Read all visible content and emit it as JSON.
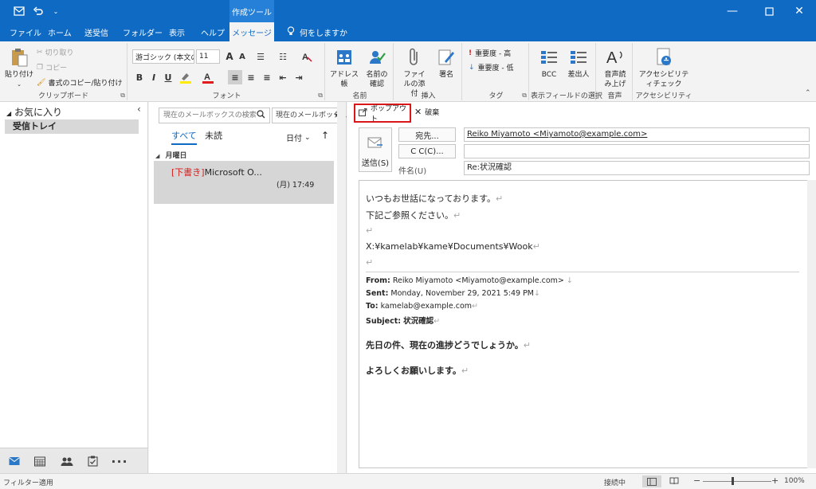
{
  "titlebar": {
    "context_tab": "作成ツール",
    "qat_icons": [
      "mail-app-icon",
      "undo-icon",
      "customize-qat-icon"
    ],
    "window_controls": [
      "minimize-icon",
      "maximize-icon",
      "close-icon"
    ]
  },
  "tabs": [
    {
      "label": "ファイル"
    },
    {
      "label": "ホーム"
    },
    {
      "label": "送受信"
    },
    {
      "label": "フォルダー"
    },
    {
      "label": "表示"
    },
    {
      "label": "ヘルプ"
    },
    {
      "label": "メッセージ",
      "active": true
    }
  ],
  "tell_me": "何をしますか",
  "ribbon": {
    "clipboard": {
      "paste": "貼り付け",
      "cut": "切り取り",
      "copy": "コピー",
      "format_painter": "書式のコピー/貼り付け",
      "label": "クリップボード"
    },
    "font": {
      "font_name": "游ゴシック (本文のフォ",
      "font_size": "11",
      "grow": "A",
      "shrink": "A",
      "bold": "B",
      "italic": "I",
      "underline": "U",
      "label": "フォント"
    },
    "names": {
      "address_book": "アドレス帳",
      "check_names": "名前の確認",
      "label": "名前"
    },
    "include": {
      "attach": "ファイルの添付",
      "signature": "署名",
      "label": "挿入"
    },
    "tags": {
      "high": "重要度 - 高",
      "low": "重要度 - 低",
      "label": "タグ"
    },
    "show_fields": {
      "bcc": "BCC",
      "from": "差出人",
      "label": "表示フィールドの選択"
    },
    "voice": {
      "dictate": "音声読み上げ",
      "label": "音声"
    },
    "accessibility": {
      "check": "アクセシビリティチェック",
      "label": "アクセシビリティ"
    }
  },
  "folder_pane": {
    "favorites": "お気に入り",
    "inbox": "受信トレイ",
    "nav_icons": [
      "mail-icon",
      "calendar-icon",
      "people-icon",
      "tasks-icon",
      "more-icon"
    ]
  },
  "message_list": {
    "search_placeholder": "現在のメールボックスの検索",
    "scope": "現在のメールボックス",
    "filter_all": "すべて",
    "filter_unread": "未読",
    "sort": "日付",
    "group": "月曜日",
    "items": [
      {
        "draft_tag": "[下書き]",
        "sender": "Microsoft O...",
        "time": "(月) 17:49"
      }
    ]
  },
  "compose": {
    "popout": "ポップアウト",
    "discard": "破棄",
    "send": "送信(S)",
    "to_button": "宛先...",
    "cc_button": "C C(C)...",
    "subject_label": "件名(U)",
    "to_value": "Reiko Miyamoto <Miyamoto@example.com>",
    "cc_value": "",
    "subject_value": "Re:状況確認",
    "body_lines": [
      "いつもお世話になっております。",
      "下記ご参照ください。",
      "",
      "X:¥kamelab¥kame¥Documents¥Wook",
      ""
    ],
    "quoted": {
      "from_label": "From:",
      "from": "Reiko Miyamoto <Miyamoto@example.com>",
      "sent_label": "Sent:",
      "sent": "Monday, November 29, 2021 5:49 PM",
      "to_label": "To:",
      "to": "kamelab@example.com",
      "subject_label": "Subject:",
      "subject": "状況確認",
      "line1": "先日の件、現在の進捗どうでしょうか。",
      "line2": "よろしくお願いします。"
    }
  },
  "status": {
    "left": "フィルター適用",
    "connection": "接続中",
    "zoom": "100%"
  }
}
